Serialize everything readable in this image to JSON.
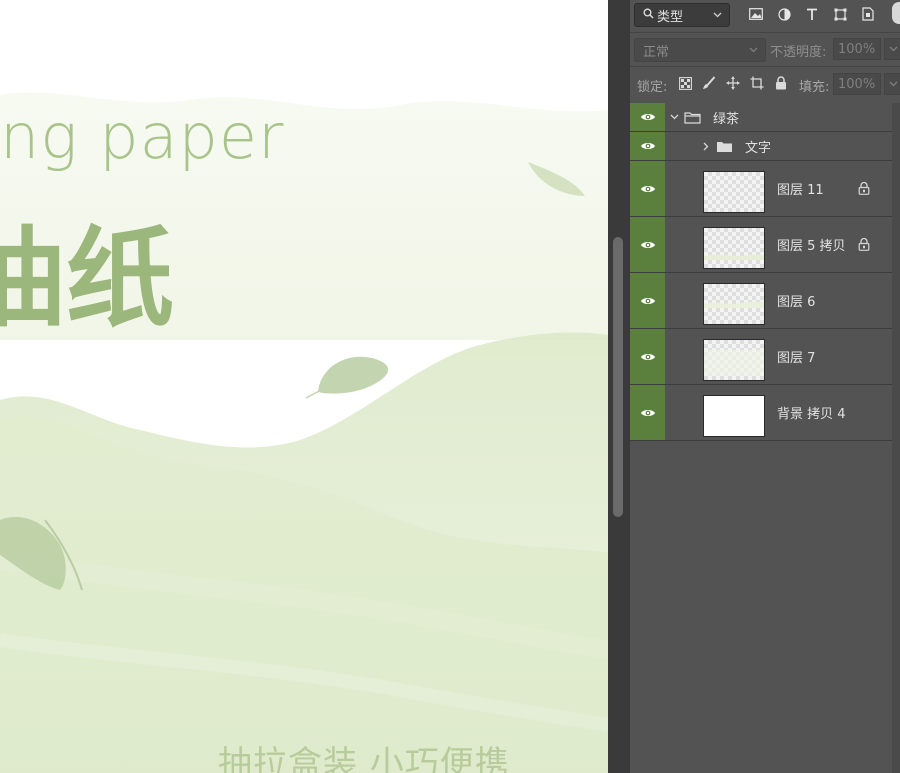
{
  "canvas": {
    "english_title": "ng paper",
    "chinese_title": "油纸",
    "bottom_text": "抽拉盒装  小巧便携",
    "accent_color": "#9cb77c"
  },
  "panel": {
    "filter": {
      "kind_label": "类型",
      "search_icon": "search-icon",
      "icons": [
        "image-filter-icon",
        "adjustment-filter-icon",
        "type-filter-icon",
        "shape-filter-icon",
        "smart-object-filter-icon"
      ]
    },
    "blend": {
      "mode_label": "正常",
      "opacity_label": "不透明度:",
      "opacity_value": "100%"
    },
    "lock": {
      "label": "锁定:",
      "icons": [
        "lock-transparent-icon",
        "lock-paint-icon",
        "lock-move-icon",
        "lock-artboard-icon",
        "lock-all-icon"
      ],
      "fill_label": "填充:",
      "fill_value": "100%"
    },
    "layers": [
      {
        "name": "绿茶",
        "type": "group",
        "expanded": true,
        "visible": true
      },
      {
        "name": "文字",
        "type": "group",
        "expanded": false,
        "visible": true
      },
      {
        "name": "图层 11",
        "type": "layer",
        "visible": true,
        "locked": true
      },
      {
        "name": "图层 5 拷贝",
        "type": "layer",
        "visible": true,
        "locked": true
      },
      {
        "name": "图层 6",
        "type": "layer",
        "visible": true,
        "locked": false
      },
      {
        "name": "图层 7",
        "type": "layer",
        "visible": true,
        "locked": false
      },
      {
        "name": "背景 拷贝 4",
        "type": "layer",
        "visible": true,
        "locked": false
      }
    ],
    "visibility_color": "#5b803e"
  }
}
